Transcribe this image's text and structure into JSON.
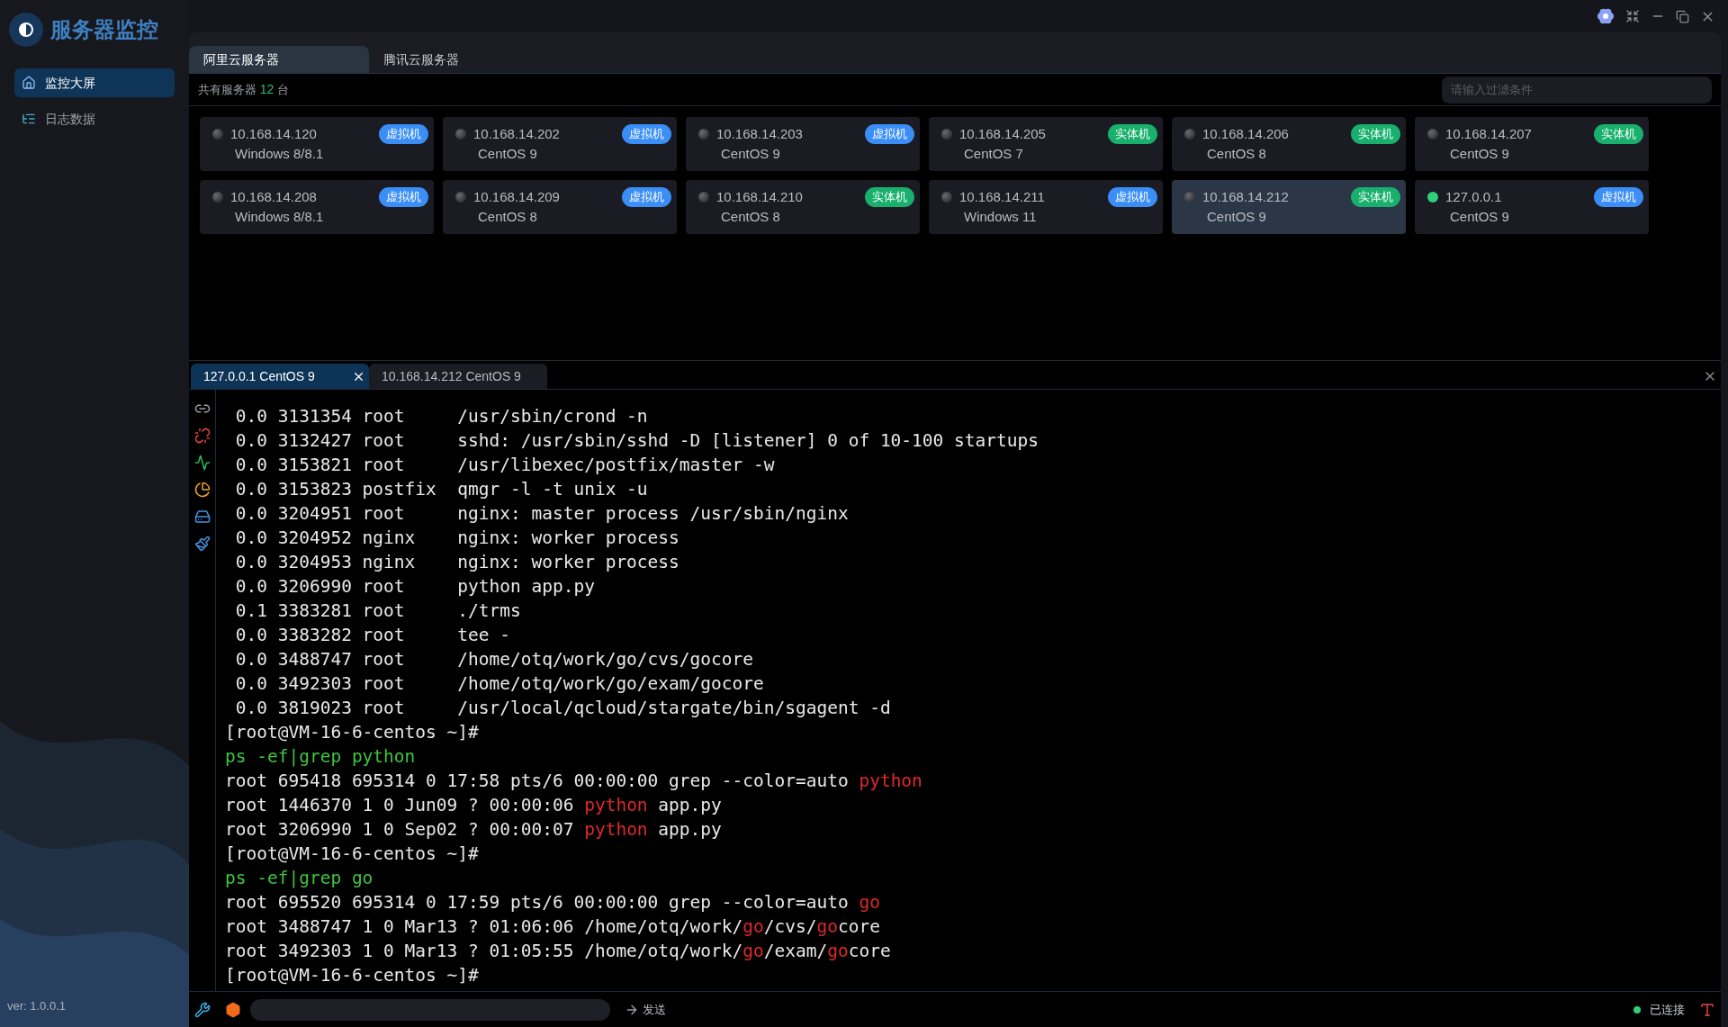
{
  "app": {
    "title": "服务器监控",
    "version": "ver: 1.0.0.1"
  },
  "sidebar": {
    "items": [
      {
        "label": "监控大屏",
        "selected": true
      },
      {
        "label": "日志数据",
        "selected": false
      }
    ]
  },
  "provider_tabs": [
    {
      "label": "阿里云服务器",
      "selected": true
    },
    {
      "label": "腾讯云服务器",
      "selected": false
    }
  ],
  "summary": {
    "prefix": "共有服务器",
    "count": "12",
    "suffix": "台"
  },
  "filter": {
    "placeholder": "请输入过滤条件"
  },
  "servers": [
    {
      "ip": "10.168.14.120",
      "os": "Windows 8/8.1",
      "online": false,
      "selected": false,
      "tag": {
        "label": "虚拟机",
        "color": "#3a8ef6"
      }
    },
    {
      "ip": "10.168.14.202",
      "os": "CentOS 9",
      "online": false,
      "selected": false,
      "tag": {
        "label": "虚拟机",
        "color": "#3a8ef6"
      }
    },
    {
      "ip": "10.168.14.203",
      "os": "CentOS 9",
      "online": false,
      "selected": false,
      "tag": {
        "label": "虚拟机",
        "color": "#3a8ef6"
      }
    },
    {
      "ip": "10.168.14.205",
      "os": "CentOS 7",
      "online": false,
      "selected": false,
      "tag": {
        "label": "实体机",
        "color": "#18b06c"
      }
    },
    {
      "ip": "10.168.14.206",
      "os": "CentOS 8",
      "online": false,
      "selected": false,
      "tag": {
        "label": "实体机",
        "color": "#18b06c"
      }
    },
    {
      "ip": "10.168.14.207",
      "os": "CentOS 9",
      "online": false,
      "selected": false,
      "tag": {
        "label": "实体机",
        "color": "#18b06c"
      }
    },
    {
      "ip": "10.168.14.208",
      "os": "Windows 8/8.1",
      "online": false,
      "selected": false,
      "tag": {
        "label": "虚拟机",
        "color": "#3a8ef6"
      }
    },
    {
      "ip": "10.168.14.209",
      "os": "CentOS 8",
      "online": false,
      "selected": false,
      "tag": {
        "label": "虚拟机",
        "color": "#3a8ef6"
      }
    },
    {
      "ip": "10.168.14.210",
      "os": "CentOS 8",
      "online": false,
      "selected": false,
      "tag": {
        "label": "实体机",
        "color": "#18b06c"
      }
    },
    {
      "ip": "10.168.14.211",
      "os": "Windows 11",
      "online": false,
      "selected": false,
      "tag": {
        "label": "虚拟机",
        "color": "#3a8ef6"
      }
    },
    {
      "ip": "10.168.14.212",
      "os": "CentOS 9",
      "online": false,
      "selected": true,
      "tag": {
        "label": "实体机",
        "color": "#18b06c"
      }
    },
    {
      "ip": "127.0.0.1",
      "os": "CentOS 9",
      "online": true,
      "selected": false,
      "tag": {
        "label": "虚拟机",
        "color": "#3a8ef6"
      }
    }
  ],
  "terminal_tabs": [
    {
      "label": "127.0.0.1 CentOS 9",
      "selected": true
    },
    {
      "label": "10.168.14.212 CentOS 9",
      "selected": false
    }
  ],
  "terminal": {
    "lines": [
      {
        "kind": "output",
        "parts": [
          {
            "text": " 0.0 3131354 root     /usr/sbin/crond -n",
            "match": false
          }
        ]
      },
      {
        "kind": "output",
        "parts": [
          {
            "text": " 0.0 3132427 root     sshd: /usr/sbin/sshd -D [listener] 0 of 10-100 startups",
            "match": false
          }
        ]
      },
      {
        "kind": "output",
        "parts": [
          {
            "text": " 0.0 3153821 root     /usr/libexec/postfix/master -w",
            "match": false
          }
        ]
      },
      {
        "kind": "output",
        "parts": [
          {
            "text": " 0.0 3153823 postfix  qmgr -l -t unix -u",
            "match": false
          }
        ]
      },
      {
        "kind": "output",
        "parts": [
          {
            "text": " 0.0 3204951 root     nginx: master process /usr/sbin/nginx",
            "match": false
          }
        ]
      },
      {
        "kind": "output",
        "parts": [
          {
            "text": " 0.0 3204952 nginx    nginx: worker process",
            "match": false
          }
        ]
      },
      {
        "kind": "output",
        "parts": [
          {
            "text": " 0.0 3204953 nginx    nginx: worker process",
            "match": false
          }
        ]
      },
      {
        "kind": "output",
        "parts": [
          {
            "text": " 0.0 3206990 root     python app.py",
            "match": false
          }
        ]
      },
      {
        "kind": "output",
        "parts": [
          {
            "text": " 0.1 3383281 root     ./trms",
            "match": false
          }
        ]
      },
      {
        "kind": "output",
        "parts": [
          {
            "text": " 0.0 3383282 root     tee -",
            "match": false
          }
        ]
      },
      {
        "kind": "output",
        "parts": [
          {
            "text": " 0.0 3488747 root     /home/otq/work/go/cvs/gocore",
            "match": false
          }
        ]
      },
      {
        "kind": "output",
        "parts": [
          {
            "text": " 0.0 3492303 root     /home/otq/work/go/exam/gocore",
            "match": false
          }
        ]
      },
      {
        "kind": "output",
        "parts": [
          {
            "text": " 0.0 3819023 root     /usr/local/qcloud/stargate/bin/sgagent -d",
            "match": false
          }
        ]
      },
      {
        "kind": "output",
        "parts": [
          {
            "text": "[root@VM-16-6-centos ~]#",
            "match": false
          }
        ]
      },
      {
        "kind": "command",
        "parts": [
          {
            "text": "ps -ef|grep python",
            "match": false
          }
        ]
      },
      {
        "kind": "output",
        "parts": [
          {
            "text": "root 695418 695314 0 17:58 pts/6 00:00:00 grep --color=auto ",
            "match": false
          },
          {
            "text": "python",
            "match": true
          }
        ]
      },
      {
        "kind": "output",
        "parts": [
          {
            "text": "root 1446370 1 0 Jun09 ? 00:00:06 ",
            "match": false
          },
          {
            "text": "python",
            "match": true
          },
          {
            "text": " app.py",
            "match": false
          }
        ]
      },
      {
        "kind": "output",
        "parts": [
          {
            "text": "root 3206990 1 0 Sep02 ? 00:00:07 ",
            "match": false
          },
          {
            "text": "python",
            "match": true
          },
          {
            "text": " app.py",
            "match": false
          }
        ]
      },
      {
        "kind": "output",
        "parts": [
          {
            "text": "[root@VM-16-6-centos ~]#",
            "match": false
          }
        ]
      },
      {
        "kind": "command",
        "parts": [
          {
            "text": "ps -ef|grep go",
            "match": false
          }
        ]
      },
      {
        "kind": "output",
        "parts": [
          {
            "text": "root 695520 695314 0 17:59 pts/6 00:00:00 grep --color=auto ",
            "match": false
          },
          {
            "text": "go",
            "match": true
          }
        ]
      },
      {
        "kind": "output",
        "parts": [
          {
            "text": "root 3488747 1 0 Mar13 ? 01:06:06 /home/otq/work/",
            "match": false
          },
          {
            "text": "go",
            "match": true
          },
          {
            "text": "/cvs/",
            "match": false
          },
          {
            "text": "go",
            "match": true
          },
          {
            "text": "core",
            "match": false
          }
        ]
      },
      {
        "kind": "output",
        "parts": [
          {
            "text": "root 3492303 1 0 Mar13 ? 01:05:55 /home/otq/work/",
            "match": false
          },
          {
            "text": "go",
            "match": true
          },
          {
            "text": "/exam/",
            "match": false
          },
          {
            "text": "go",
            "match": true
          },
          {
            "text": "core",
            "match": false
          }
        ]
      },
      {
        "kind": "output",
        "parts": [
          {
            "text": "[root@VM-16-6-centos ~]#",
            "match": false
          }
        ]
      }
    ]
  },
  "send": {
    "label": "发送"
  },
  "status": {
    "label": "已连接",
    "connected": true
  }
}
